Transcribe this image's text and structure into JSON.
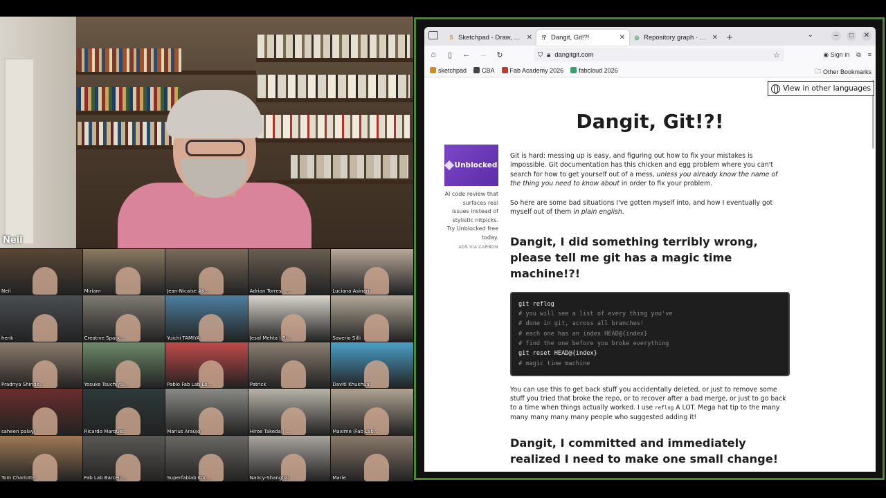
{
  "speaker": {
    "name": "Neil"
  },
  "participants": [
    {
      "name": "Neil",
      "color": "#5a4636"
    },
    {
      "name": "Miriam",
      "color": "#8a7a62"
    },
    {
      "name": "Jean-Nicaise AK...",
      "color": "#7a6a5a"
    },
    {
      "name": "Adrian Torres - ...",
      "color": "#6a5e52"
    },
    {
      "name": "Luciana Asinari",
      "color": "#b8a79a"
    },
    {
      "name": "henk",
      "color": "#4a4e52"
    },
    {
      "name": "Creative Spark...",
      "color": "#7f7a72"
    },
    {
      "name": "Yuichi TAMIYA",
      "color": "#4e7fa0"
    },
    {
      "name": "Jesal Mehta | Ri...",
      "color": "#d8d4cc"
    },
    {
      "name": "Saverio Silli",
      "color": "#b2a898"
    },
    {
      "name": "Pradnya Shinde...",
      "color": "#8c7c6e"
    },
    {
      "name": "Yosuke Tsuchiya...",
      "color": "#6e8a6a"
    },
    {
      "name": "Pablo Fab Lab Le...",
      "color": "#c04a4a"
    },
    {
      "name": "Patrick",
      "color": "#8a7e70"
    },
    {
      "name": "Daviti Khukhua",
      "color": "#4aa0c8"
    },
    {
      "name": "saheen palayi",
      "color": "#6a2e2e"
    },
    {
      "name": "Ricardo Marques",
      "color": "#2e3a3a"
    },
    {
      "name": "Marius Araújo",
      "color": "#8a8a86"
    },
    {
      "name": "Hiroe Takeda | ...",
      "color": "#b8b4aa"
    },
    {
      "name": "Maxime (Fab Lab...",
      "color": "#b0a494"
    },
    {
      "name": "Tom Charlotte",
      "color": "#a07a56"
    },
    {
      "name": "Fab Lab Barcelo...",
      "color": "#5a5854"
    },
    {
      "name": "Superfablab Koc...",
      "color": "#6a6864"
    },
    {
      "name": "Nancy-Shanghai",
      "color": "#a8a49e"
    },
    {
      "name": "Marie",
      "color": "#8a7a6c"
    }
  ],
  "browser": {
    "tabs": [
      {
        "title": "Sketchpad - Draw, Create",
        "fav": "S",
        "favColor": "#d98a1e",
        "active": false
      },
      {
        "title": "Dangit, Git!?!",
        "fav": "⁉",
        "favColor": "#333333",
        "active": true
      },
      {
        "title": "Repository graph · main",
        "fav": "◎",
        "favColor": "#3aa06a",
        "active": false
      }
    ],
    "url": "dangitgit.com",
    "sign_in": "Sign in",
    "bookmarks": [
      {
        "label": "sketchpad",
        "color": "#d98a1e"
      },
      {
        "label": "CBA",
        "color": "#444444"
      },
      {
        "label": "Fab Academy 2026",
        "color": "#c0392b"
      },
      {
        "label": "fabcloud 2026",
        "color": "#3aa06a"
      }
    ],
    "other_bookmarks": "Other Bookmarks"
  },
  "page": {
    "lang_button": "View in other languages",
    "title": "Dangit, Git!?!",
    "ad": {
      "brand": "Unblocked",
      "copy": "AI code review that surfaces real issues instead of stylistic nitpicks. Try Unblocked free today.",
      "via": "ADS VIA CARBON"
    },
    "intro_1a": "Git is hard: messing up is easy, and figuring out how to fix your mistakes is impossible. Git documentation has this chicken and egg problem where you can't search for how to get yourself out of a mess, ",
    "intro_1_em": "unless you already know the name of the thing you need to know about",
    "intro_1b": " in order to fix your problem.",
    "intro_2a": "So here are some bad situations I've gotten myself into, and how I eventually got myself out of them ",
    "intro_2_em": "in plain english",
    "intro_2b": ".",
    "section1_heading": "Dangit, I did something terribly wrong, please tell me git has a magic time machine!?!",
    "code1": [
      {
        "text": "git reflog",
        "kind": "cmd"
      },
      {
        "text": "# you will see a list of every thing you've",
        "kind": "cmt"
      },
      {
        "text": "# done in git, across all branches!",
        "kind": "cmt"
      },
      {
        "text": "# each one has an index HEAD@{index}",
        "kind": "cmt"
      },
      {
        "text": "# find the one before you broke everything",
        "kind": "cmt"
      },
      {
        "text": "git reset HEAD@{index}",
        "kind": "cmd"
      },
      {
        "text": "# magic time machine",
        "kind": "cmt"
      }
    ],
    "section1_text_a": "You can use this to get back stuff you accidentally deleted, or just to remove some stuff you tried that broke the repo, or to recover after a bad merge, or just to go back to a time when things actually worked. I use ",
    "section1_text_code": "reflog",
    "section1_text_b": " A LOT. Mega hat tip to the many many many many many people who suggested adding it!",
    "section2_heading": "Dangit, I committed and immediately realized I need to make one small change!"
  }
}
